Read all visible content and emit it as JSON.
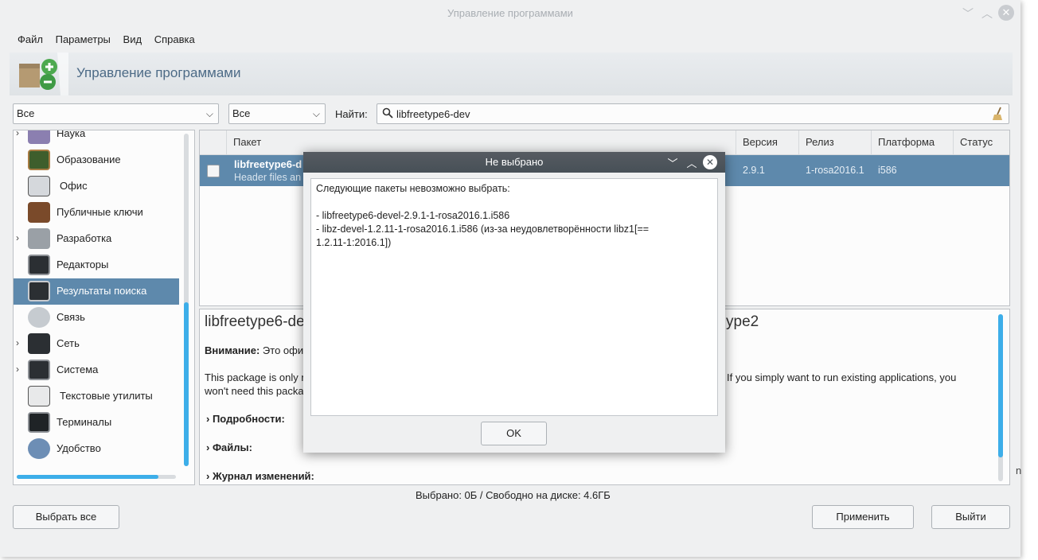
{
  "window": {
    "title": "Управление программами",
    "btn_minimize": "﹀",
    "btn_maximize": "︿",
    "btn_close": "✕"
  },
  "menu": [
    "Файл",
    "Параметры",
    "Вид",
    "Справка"
  ],
  "banner": {
    "title": "Управление программами"
  },
  "filters": {
    "filter1": "Все",
    "filter2": "Все",
    "search_label": "Найти:",
    "search_value": "libfreetype6-dev"
  },
  "categories": [
    {
      "label": "Наука",
      "arrow": "›"
    },
    {
      "label": "Образование",
      "arrow": ""
    },
    {
      "label": "Офис",
      "arrow": ""
    },
    {
      "label": "Публичные ключи",
      "arrow": ""
    },
    {
      "label": "Разработка",
      "arrow": "›"
    },
    {
      "label": "Редакторы",
      "arrow": ""
    },
    {
      "label": "Результаты поиска",
      "arrow": ""
    },
    {
      "label": "Связь",
      "arrow": ""
    },
    {
      "label": "Сеть",
      "arrow": "›"
    },
    {
      "label": "Система",
      "arrow": "›"
    },
    {
      "label": "Текстовые утилиты",
      "arrow": ""
    },
    {
      "label": "Терминалы",
      "arrow": ""
    },
    {
      "label": "Удобство",
      "arrow": ""
    }
  ],
  "table": {
    "headers": {
      "package": "Пакет",
      "version": "Версия",
      "release": "Релиз",
      "platform": "Платформа",
      "status": "Статус"
    },
    "row": {
      "name": "libfreetype6-d",
      "desc": "Header files an",
      "version": "2.9.1",
      "release": "1-rosa2016.1",
      "platform": "i586"
    }
  },
  "details": {
    "title_left": "libfreetype6-de",
    "title_right": "ype2",
    "warning_label": "Внимание:",
    "warning_text": " Это офи",
    "desc_line1_left": "This package is only n",
    "desc_line1_right": "If you simply want to run existing applications, you",
    "desc_line2": "won't need this packa",
    "sections": [
      "Подробности:",
      "Файлы:",
      "Журнал изменений:"
    ],
    "edge_char": "n"
  },
  "status": "Выбрано: 0Б / Свободно на диске: 4.6ГБ",
  "buttons": {
    "select_all": "Выбрать все",
    "apply": "Применить",
    "quit": "Выйти"
  },
  "dialog": {
    "title": "Не выбрано",
    "line1": "Следующие пакеты невозможно выбрать:",
    "item1": "- libfreetype6-devel-2.9.1-1-rosa2016.1.i586",
    "item2": "- libz-devel-1.2.11-1-rosa2016.1.i586 (из-за неудовлетворённости libz1[==",
    "item2_cont": "1.2.11-1:2016.1])",
    "ok": "OK",
    "btn_minimize": "﹀",
    "btn_maximize": "︿",
    "btn_close": "✕"
  },
  "colors": {
    "selection": "#5e89ac",
    "accent": "#3daee9",
    "dialog_title": "#4c545b"
  }
}
